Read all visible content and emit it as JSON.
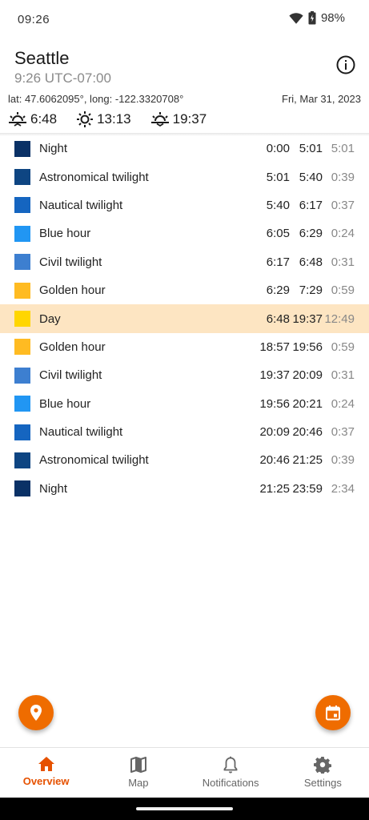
{
  "status_bar": {
    "time": "09:26",
    "battery": "98%"
  },
  "header": {
    "city": "Seattle",
    "local_time": "9:26 UTC-07:00",
    "coordinates": "lat: 47.6062095°, long: -122.3320708°",
    "date": "Fri, Mar 31, 2023",
    "sunrise": "6:48",
    "solar_noon": "13:13",
    "sunset": "19:37"
  },
  "colors": {
    "night": "#0a3166",
    "astronomical": "#0e4582",
    "nautical": "#1565c0",
    "blue_hour": "#2196f3",
    "civil": "#3d7fd0",
    "golden": "#ffbb22",
    "day": "#ffd600",
    "accent": "#ef6c00",
    "highlight": "#fde5c2"
  },
  "phases": [
    {
      "label": "Night",
      "start": "0:00",
      "end": "5:01",
      "duration": "5:01",
      "color": "#0a3166"
    },
    {
      "label": "Astronomical twilight",
      "start": "5:01",
      "end": "5:40",
      "duration": "0:39",
      "color": "#0e4582"
    },
    {
      "label": "Nautical twilight",
      "start": "5:40",
      "end": "6:17",
      "duration": "0:37",
      "color": "#1565c0"
    },
    {
      "label": "Blue hour",
      "start": "6:05",
      "end": "6:29",
      "duration": "0:24",
      "color": "#2196f3"
    },
    {
      "label": "Civil twilight",
      "start": "6:17",
      "end": "6:48",
      "duration": "0:31",
      "color": "#3d7fd0"
    },
    {
      "label": "Golden hour",
      "start": "6:29",
      "end": "7:29",
      "duration": "0:59",
      "color": "#ffbb22"
    },
    {
      "label": "Day",
      "start": "6:48",
      "end": "19:37",
      "duration": "12:49",
      "color": "#ffd600",
      "highlight": true
    },
    {
      "label": "Golden hour",
      "start": "18:57",
      "end": "19:56",
      "duration": "0:59",
      "color": "#ffbb22"
    },
    {
      "label": "Civil twilight",
      "start": "19:37",
      "end": "20:09",
      "duration": "0:31",
      "color": "#3d7fd0"
    },
    {
      "label": "Blue hour",
      "start": "19:56",
      "end": "20:21",
      "duration": "0:24",
      "color": "#2196f3"
    },
    {
      "label": "Nautical twilight",
      "start": "20:09",
      "end": "20:46",
      "duration": "0:37",
      "color": "#1565c0"
    },
    {
      "label": "Astronomical twilight",
      "start": "20:46",
      "end": "21:25",
      "duration": "0:39",
      "color": "#0e4582"
    },
    {
      "label": "Night",
      "start": "21:25",
      "end": "23:59",
      "duration": "2:34",
      "color": "#0a3166"
    }
  ],
  "fabs": {
    "left_icon": "location-pin-icon",
    "right_icon": "calendar-icon"
  },
  "nav": [
    {
      "label": "Overview",
      "icon": "home-icon",
      "active": true
    },
    {
      "label": "Map",
      "icon": "map-icon",
      "active": false
    },
    {
      "label": "Notifications",
      "icon": "bell-icon",
      "active": false
    },
    {
      "label": "Settings",
      "icon": "gear-icon",
      "active": false
    }
  ]
}
